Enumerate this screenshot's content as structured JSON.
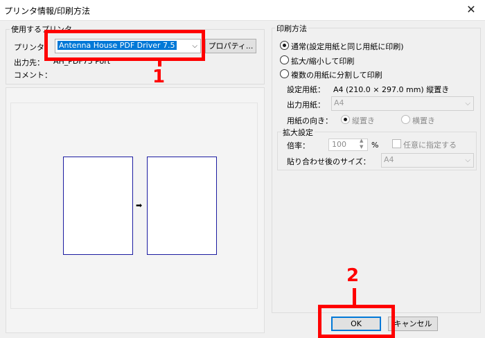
{
  "window": {
    "title": "プリンタ情報/印刷方法",
    "close_glyph": "✕"
  },
  "printer_group": {
    "title": "使用するプリンタ",
    "printer_label": "プリンタ",
    "printer_value": "Antenna House PDF Driver 7.5",
    "properties_button": "プロパティ...",
    "output_label": "出力先：",
    "output_value": "AH_PDF75 Port",
    "comment_label": "コメント："
  },
  "print_method": {
    "title": "印刷方法",
    "options": [
      {
        "label": "通常(設定用紙と同じ用紙に印刷)",
        "selected": true
      },
      {
        "label": "拡大/縮小して印刷",
        "selected": false
      },
      {
        "label": "複数の用紙に分割して印刷",
        "selected": false
      }
    ],
    "paper_setting_label": "設定用紙：",
    "paper_setting_value": "A4 (210.0 × 297.0 mm) 縦置き",
    "output_paper_label": "出力用紙：",
    "output_paper_value": "A4",
    "orientation_label": "用紙の向き：",
    "orientation_portrait": "縦置き",
    "orientation_landscape": "横置き",
    "zoom_group": {
      "title": "拡大設定",
      "ratio_label": "倍率：",
      "ratio_value": "100",
      "ratio_unit": "%",
      "custom_checkbox": "任意に指定する",
      "size_label": "貼り合わせ後のサイズ：",
      "size_value": "A4"
    }
  },
  "preview": {
    "arrow_glyph": "➡"
  },
  "buttons": {
    "ok": "OK",
    "cancel": "キャンセル"
  },
  "annotations": {
    "marker1": "1",
    "marker2": "2",
    "marker_color": "#ff0000"
  }
}
